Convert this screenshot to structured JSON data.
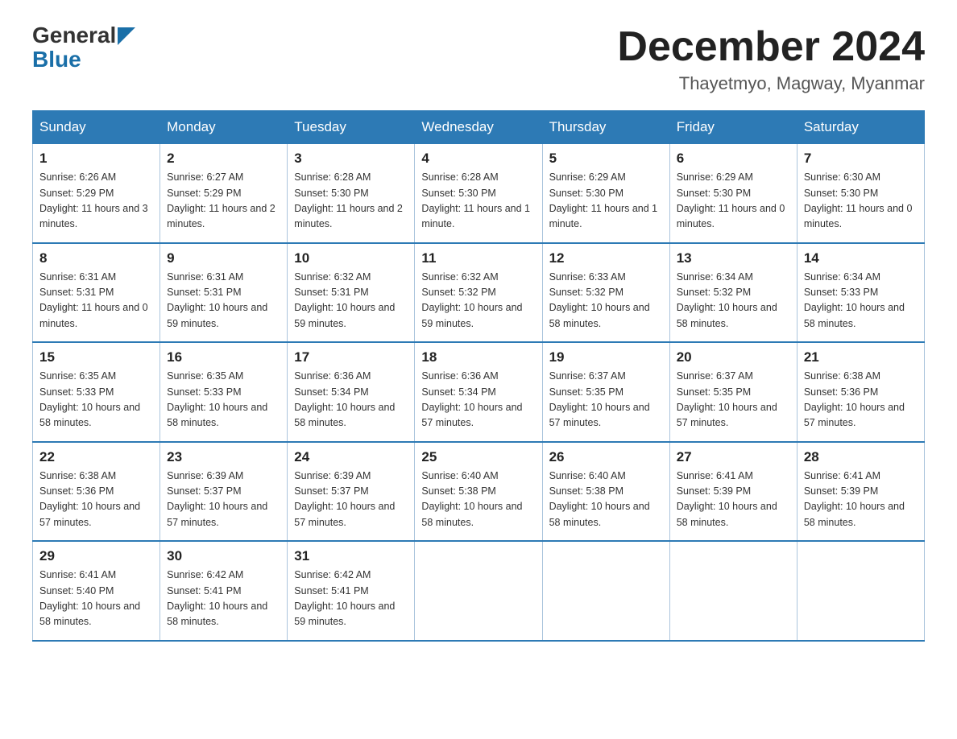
{
  "logo": {
    "part1": "General",
    "part2": "Blue"
  },
  "title": "December 2024",
  "location": "Thayetmyo, Magway, Myanmar",
  "days_of_week": [
    "Sunday",
    "Monday",
    "Tuesday",
    "Wednesday",
    "Thursday",
    "Friday",
    "Saturday"
  ],
  "weeks": [
    [
      {
        "day": "1",
        "sunrise": "6:26 AM",
        "sunset": "5:29 PM",
        "daylight": "11 hours and 3 minutes."
      },
      {
        "day": "2",
        "sunrise": "6:27 AM",
        "sunset": "5:29 PM",
        "daylight": "11 hours and 2 minutes."
      },
      {
        "day": "3",
        "sunrise": "6:28 AM",
        "sunset": "5:30 PM",
        "daylight": "11 hours and 2 minutes."
      },
      {
        "day": "4",
        "sunrise": "6:28 AM",
        "sunset": "5:30 PM",
        "daylight": "11 hours and 1 minute."
      },
      {
        "day": "5",
        "sunrise": "6:29 AM",
        "sunset": "5:30 PM",
        "daylight": "11 hours and 1 minute."
      },
      {
        "day": "6",
        "sunrise": "6:29 AM",
        "sunset": "5:30 PM",
        "daylight": "11 hours and 0 minutes."
      },
      {
        "day": "7",
        "sunrise": "6:30 AM",
        "sunset": "5:30 PM",
        "daylight": "11 hours and 0 minutes."
      }
    ],
    [
      {
        "day": "8",
        "sunrise": "6:31 AM",
        "sunset": "5:31 PM",
        "daylight": "11 hours and 0 minutes."
      },
      {
        "day": "9",
        "sunrise": "6:31 AM",
        "sunset": "5:31 PM",
        "daylight": "10 hours and 59 minutes."
      },
      {
        "day": "10",
        "sunrise": "6:32 AM",
        "sunset": "5:31 PM",
        "daylight": "10 hours and 59 minutes."
      },
      {
        "day": "11",
        "sunrise": "6:32 AM",
        "sunset": "5:32 PM",
        "daylight": "10 hours and 59 minutes."
      },
      {
        "day": "12",
        "sunrise": "6:33 AM",
        "sunset": "5:32 PM",
        "daylight": "10 hours and 58 minutes."
      },
      {
        "day": "13",
        "sunrise": "6:34 AM",
        "sunset": "5:32 PM",
        "daylight": "10 hours and 58 minutes."
      },
      {
        "day": "14",
        "sunrise": "6:34 AM",
        "sunset": "5:33 PM",
        "daylight": "10 hours and 58 minutes."
      }
    ],
    [
      {
        "day": "15",
        "sunrise": "6:35 AM",
        "sunset": "5:33 PM",
        "daylight": "10 hours and 58 minutes."
      },
      {
        "day": "16",
        "sunrise": "6:35 AM",
        "sunset": "5:33 PM",
        "daylight": "10 hours and 58 minutes."
      },
      {
        "day": "17",
        "sunrise": "6:36 AM",
        "sunset": "5:34 PM",
        "daylight": "10 hours and 58 minutes."
      },
      {
        "day": "18",
        "sunrise": "6:36 AM",
        "sunset": "5:34 PM",
        "daylight": "10 hours and 57 minutes."
      },
      {
        "day": "19",
        "sunrise": "6:37 AM",
        "sunset": "5:35 PM",
        "daylight": "10 hours and 57 minutes."
      },
      {
        "day": "20",
        "sunrise": "6:37 AM",
        "sunset": "5:35 PM",
        "daylight": "10 hours and 57 minutes."
      },
      {
        "day": "21",
        "sunrise": "6:38 AM",
        "sunset": "5:36 PM",
        "daylight": "10 hours and 57 minutes."
      }
    ],
    [
      {
        "day": "22",
        "sunrise": "6:38 AM",
        "sunset": "5:36 PM",
        "daylight": "10 hours and 57 minutes."
      },
      {
        "day": "23",
        "sunrise": "6:39 AM",
        "sunset": "5:37 PM",
        "daylight": "10 hours and 57 minutes."
      },
      {
        "day": "24",
        "sunrise": "6:39 AM",
        "sunset": "5:37 PM",
        "daylight": "10 hours and 57 minutes."
      },
      {
        "day": "25",
        "sunrise": "6:40 AM",
        "sunset": "5:38 PM",
        "daylight": "10 hours and 58 minutes."
      },
      {
        "day": "26",
        "sunrise": "6:40 AM",
        "sunset": "5:38 PM",
        "daylight": "10 hours and 58 minutes."
      },
      {
        "day": "27",
        "sunrise": "6:41 AM",
        "sunset": "5:39 PM",
        "daylight": "10 hours and 58 minutes."
      },
      {
        "day": "28",
        "sunrise": "6:41 AM",
        "sunset": "5:39 PM",
        "daylight": "10 hours and 58 minutes."
      }
    ],
    [
      {
        "day": "29",
        "sunrise": "6:41 AM",
        "sunset": "5:40 PM",
        "daylight": "10 hours and 58 minutes."
      },
      {
        "day": "30",
        "sunrise": "6:42 AM",
        "sunset": "5:41 PM",
        "daylight": "10 hours and 58 minutes."
      },
      {
        "day": "31",
        "sunrise": "6:42 AM",
        "sunset": "5:41 PM",
        "daylight": "10 hours and 59 minutes."
      },
      null,
      null,
      null,
      null
    ]
  ]
}
